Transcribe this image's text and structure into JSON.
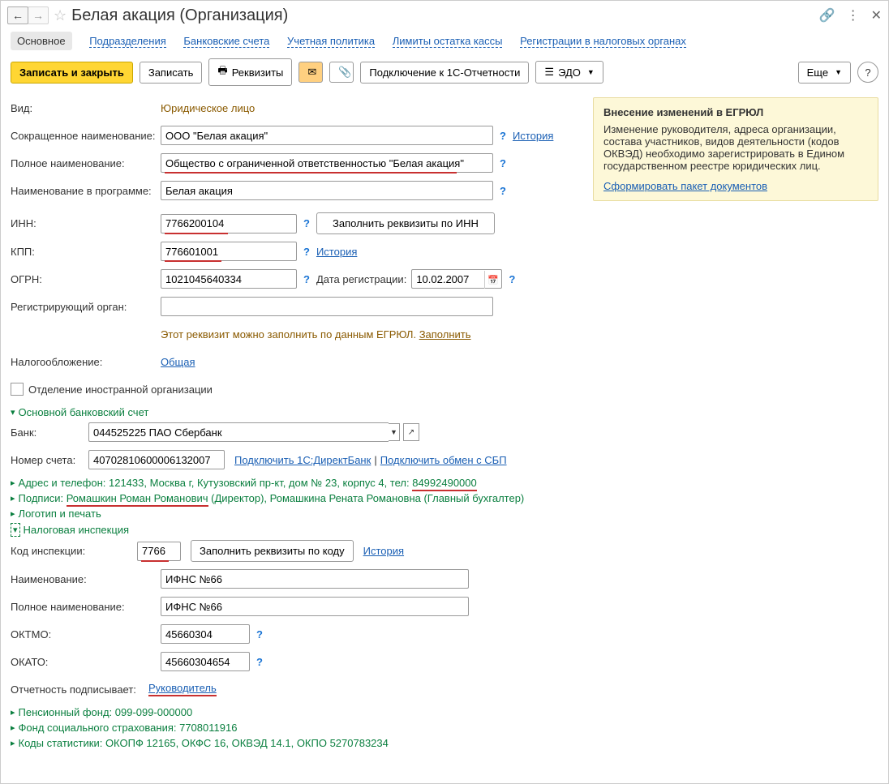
{
  "title": "Белая акация (Организация)",
  "tabs": {
    "main": "Основное",
    "subdiv": "Подразделения",
    "bank": "Банковские счета",
    "acct": "Учетная политика",
    "limits": "Лимиты остатка кассы",
    "tax": "Регистрации в налоговых органах"
  },
  "toolbar": {
    "saveclose": "Записать и закрыть",
    "save": "Записать",
    "req": "Реквизиты",
    "conn": "Подключение к 1С-Отчетности",
    "edo": "ЭДО",
    "more": "Еще",
    "help": "?"
  },
  "info": {
    "title": "Внесение изменений в ЕГРЮЛ",
    "body": "Изменение руководителя, адреса организации, состава участников, видов деятельности (кодов ОКВЭД) необходимо зарегистрировать в Едином государственном реестре юридических лиц.",
    "link": "Сформировать пакет документов"
  },
  "f": {
    "kind_lbl": "Вид:",
    "kind": "Юридическое лицо",
    "short_lbl": "Сокращенное наименование:",
    "short": "ООО \"Белая акация\"",
    "history": "История",
    "full_lbl": "Полное наименование:",
    "full": "Общество с ограниченной ответственностью \"Белая акация\"",
    "prog_lbl": "Наименование в программе:",
    "prog": "Белая акация",
    "inn_lbl": "ИНН:",
    "inn": "7766200104",
    "inn_btn": "Заполнить реквизиты по ИНН",
    "kpp_lbl": "КПП:",
    "kpp": "776601001",
    "ogrn_lbl": "ОГРН:",
    "ogrn": "1021045640334",
    "regdate_lbl": "Дата регистрации:",
    "regdate": "10.02.2007",
    "regorg_lbl": "Регистрирующий орган:",
    "regorg": "",
    "reghint": "Этот реквизит можно заполнить по данным ЕГРЮЛ. ",
    "reghint_link": "Заполнить",
    "taxation_lbl": "Налогообложение:",
    "taxation": "Общая",
    "foreign": "Отделение иностранной организации",
    "bankacc": "Основной банковский счет",
    "bank_lbl": "Банк:",
    "bank": "044525225 ПАО Сбербанк",
    "accnum_lbl": "Номер счета:",
    "accnum": "40702810600006132007",
    "direct": "Подключить 1С:ДиректБанк",
    "sbp": "Подключить обмен с СБП",
    "addr_pre": "Адрес и телефон: ",
    "addr_p1": "121433, Москва г, Кутузовский пр-кт, дом № 23, корпус 4, тел: ",
    "addr_tel": "84992490000",
    "sign_pre": "Подписи: ",
    "sign_p1": "Ромашкин Роман Романович",
    "sign_p2": " (Директор), Ромашкина Рената Романовна (Главный бухгалтер)",
    "logo": "Логотип и печать",
    "taxinsp": "Налоговая инспекция",
    "code_lbl": "Код инспекции:",
    "code": "7766",
    "code_btn": "Заполнить реквизиты по коду",
    "iname_lbl": "Наименование:",
    "iname": "ИФНС №66",
    "ifull_lbl": "Полное наименование:",
    "ifull": "ИФНС №66",
    "oktmo_lbl": "ОКТМО:",
    "oktmo": "45660304",
    "okato_lbl": "ОКАТО:",
    "okato": "45660304654",
    "signer_lbl": "Отчетность подписывает:",
    "signer": "Руководитель",
    "pens": "Пенсионный фонд: 099-099-000000",
    "fss": "Фонд социального страхования: 7708011916",
    "stats": "Коды статистики: ОКОПФ 12165, ОКФС 16, ОКВЭД 14.1, ОКПО 5270783234"
  }
}
